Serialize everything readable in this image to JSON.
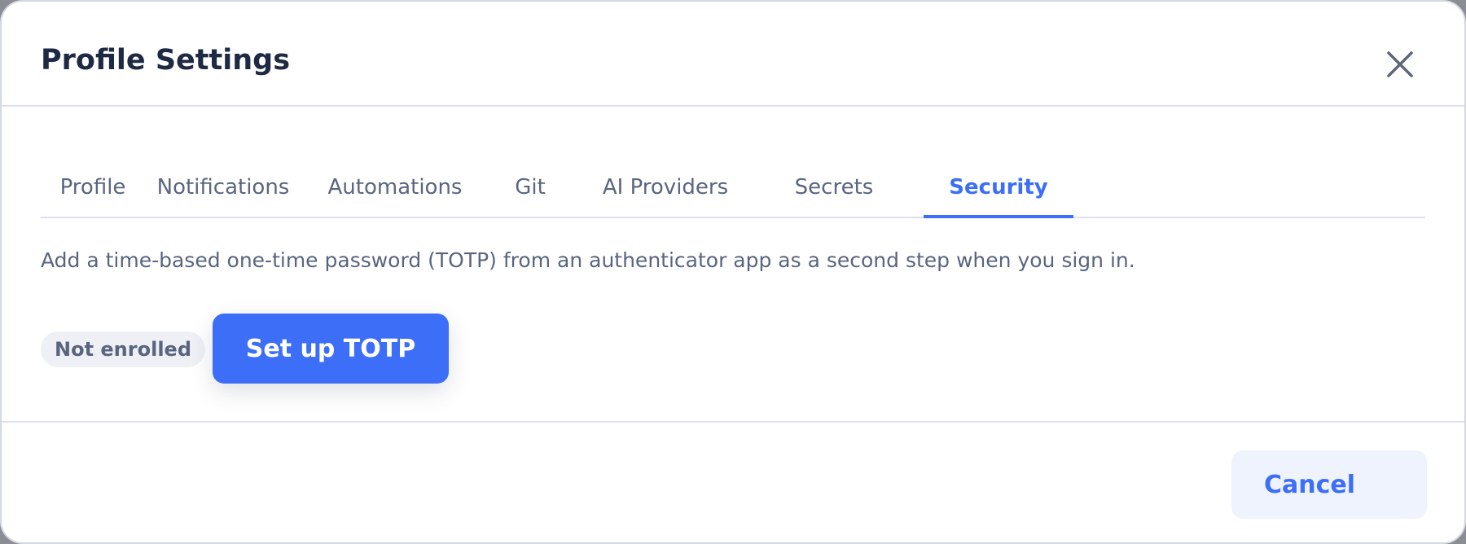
{
  "dialog": {
    "title": "Profile Settings",
    "close_icon": "close-icon"
  },
  "tabs": [
    {
      "label": "Profile",
      "active": false
    },
    {
      "label": "Notifications",
      "active": false
    },
    {
      "label": "Automations",
      "active": false
    },
    {
      "label": "Git",
      "active": false
    },
    {
      "label": "AI Providers",
      "active": false
    },
    {
      "label": "Secrets",
      "active": false
    },
    {
      "label": "Security",
      "active": true
    }
  ],
  "security": {
    "description": "Add a time-based one-time password (TOTP) from an authenticator app as a second step when you sign in.",
    "status": "Not enrolled",
    "setup_label": "Set up TOTP"
  },
  "footer": {
    "cancel_label": "Cancel"
  },
  "colors": {
    "accent": "#3d6ef7",
    "title": "#1e2a44",
    "muted_text": "#59657f",
    "badge_bg": "#eef0f5",
    "cancel_bg": "#eef3fd"
  }
}
